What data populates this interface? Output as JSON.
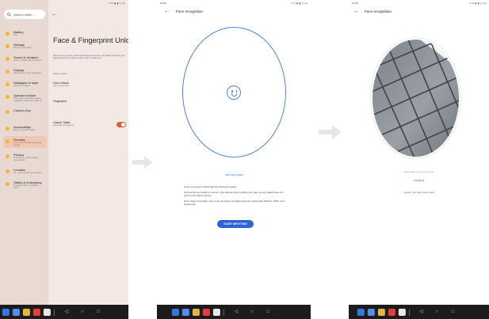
{
  "status": {
    "time": "10:38",
    "icons": "▾ ✉ ◉ ▮ ◫ ⅏"
  },
  "dock": {
    "apps": [
      {
        "name": "phone",
        "color": "#2f7be0"
      },
      {
        "name": "messages",
        "color": "#4e8ef5"
      },
      {
        "name": "chrome",
        "color": "#e6b63a"
      },
      {
        "name": "youtube",
        "color": "#e33d3d"
      },
      {
        "name": "app-grid",
        "color": "#e8e8e8"
      }
    ],
    "nav_back": "◁",
    "nav_home": "○",
    "nav_recents": "□"
  },
  "settings": {
    "search_placeholder": "Search settin...",
    "sidebar_items": [
      {
        "title": "Battery",
        "sub": "78%"
      },
      {
        "title": "Storage",
        "sub": "8% used · 236 GB free"
      },
      {
        "title": "Sound & vibration",
        "sub": "Volume, vibration, Do Not Disturb"
      },
      {
        "title": "Display",
        "sub": "Dark theme, font size, brightness"
      },
      {
        "title": "Wallpaper & style",
        "sub": "Colors, icon shapes"
      },
      {
        "title": "Special function",
        "sub": "Three finger screenshot, gesture navigation, double-tap to wake up"
      },
      {
        "title": "Custom Key",
        "sub": ""
      },
      {
        "title": "Accessibility",
        "sub": "Display, interaction, audio"
      },
      {
        "title": "Security",
        "sub": "Screen lock, Find My Device, app security"
      },
      {
        "title": "Privacy",
        "sub": "Permissions, account activity, personal data"
      },
      {
        "title": "Location",
        "sub": "On · 1 app has access to location"
      },
      {
        "title": "Safety & emergency",
        "sub": "Emergency SOS, medical info, alerts"
      }
    ],
    "active_index": 8,
    "page_title": "Face & Fingerprint Unlock",
    "description": "When you set up Face Unlock and Fingerprint Unlock, your tablet will ask for your fingerprint when you wear a mask or are in a dark area.",
    "section_label": "Ways to unlock",
    "face_unlock_title": "Face Unlock",
    "face_unlock_sub": "Tap to set up face",
    "fingerprint_title": "Fingerprint",
    "unlock_tablet_title": "Unlock Tablet",
    "unlock_tablet_sub": "Using face or fingerprint",
    "unlock_tablet_on": true
  },
  "enroll": {
    "title": "Face recognition",
    "add_face_link": "Add face data",
    "instructions": [
      "Keep your face in bright light and facing the tablet.",
      "Just look at your tablet to unlock it. Be cautious when adding your face, as any added face can perform the above actions.",
      "Note: Face recognition may not be as secure as higher-security options like patterns, PINs, and fingerprints."
    ],
    "start_button": "START INPUTTING"
  },
  "camera": {
    "title": "Face recognition",
    "hint": "Please adjust your face in the circle",
    "status": "Inputting",
    "instruction": "Center your face in the circle"
  },
  "colors": {
    "accent_blue": "#4a85e0",
    "button_blue": "#2e63d6",
    "settings_accent": "#d0643b",
    "sidebar_bg": "#e9d9d3",
    "active_item": "#f1c6b3"
  }
}
